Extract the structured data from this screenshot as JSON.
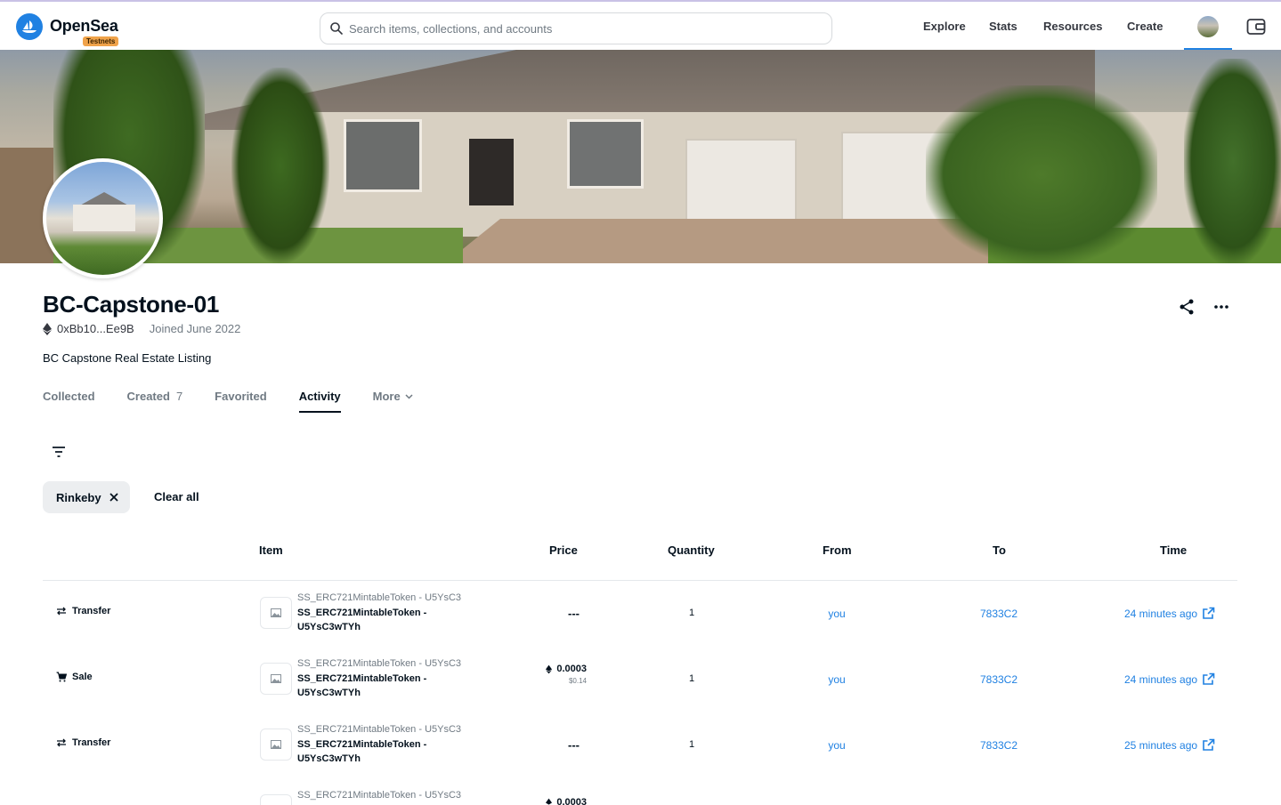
{
  "header": {
    "brand": "OpenSea",
    "badge": "Testnets",
    "search_placeholder": "Search items, collections, and accounts",
    "nav": [
      "Explore",
      "Stats",
      "Resources",
      "Create"
    ]
  },
  "profile": {
    "name": "BC-Capstone-01",
    "address": "0xBb10...Ee9B",
    "joined": "Joined June 2022",
    "description": "BC Capstone Real Estate Listing"
  },
  "tabs": [
    {
      "label": "Collected",
      "count": ""
    },
    {
      "label": "Created",
      "count": "7"
    },
    {
      "label": "Favorited",
      "count": ""
    },
    {
      "label": "Activity",
      "count": "",
      "active": true
    },
    {
      "label": "More",
      "count": ""
    }
  ],
  "filters": {
    "chip": "Rinkeby",
    "clear_all": "Clear all"
  },
  "table": {
    "headers": [
      "Item",
      "Price",
      "Quantity",
      "From",
      "To",
      "Time"
    ],
    "rows": [
      {
        "event": "Transfer",
        "collection": "SS_ERC721MintableToken - U5YsC3",
        "name_line1": "SS_ERC721MintableToken -",
        "name_line2": "U5YsC3wTYh",
        "price": "---",
        "price_eth": "",
        "price_usd": "",
        "quantity": "1",
        "from": "you",
        "to": "7833C2",
        "time": "24 minutes ago"
      },
      {
        "event": "Sale",
        "collection": "SS_ERC721MintableToken - U5YsC3",
        "name_line1": "SS_ERC721MintableToken -",
        "name_line2": "U5YsC3wTYh",
        "price": "",
        "price_eth": "0.0003",
        "price_usd": "$0.14",
        "quantity": "1",
        "from": "you",
        "to": "7833C2",
        "time": "24 minutes ago"
      },
      {
        "event": "Transfer",
        "collection": "SS_ERC721MintableToken - U5YsC3",
        "name_line1": "SS_ERC721MintableToken -",
        "name_line2": "U5YsC3wTYh",
        "price": "---",
        "price_eth": "",
        "price_usd": "",
        "quantity": "1",
        "from": "you",
        "to": "7833C2",
        "time": "25 minutes ago"
      },
      {
        "event": "",
        "collection": "SS_ERC721MintableToken - U5YsC3",
        "name_line1": "",
        "name_line2": "",
        "price": "",
        "price_eth": "0.0003",
        "price_usd": "",
        "quantity": "",
        "from": "",
        "to": "",
        "time": ""
      }
    ]
  },
  "colors": {
    "accent": "#2081e2",
    "text": "#04111d",
    "muted": "#707a83",
    "badge": "#f0a34a"
  }
}
